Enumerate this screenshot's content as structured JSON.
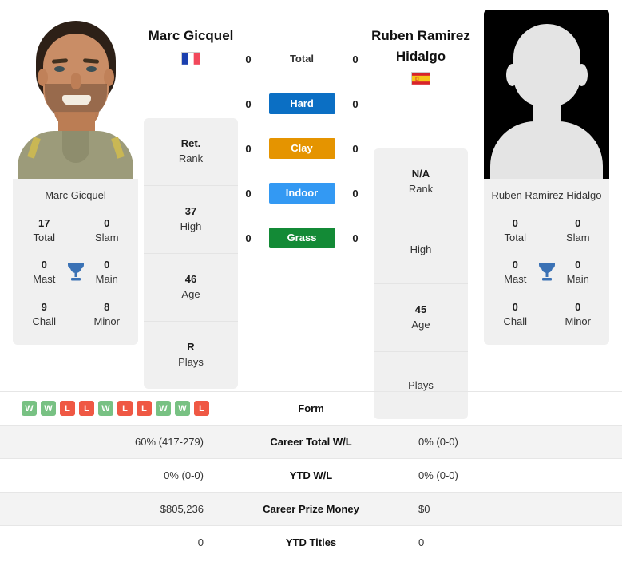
{
  "players": {
    "left": {
      "name": "Marc Gicquel",
      "card_name": "Marc Gicquel",
      "flag": "fr",
      "flag_name": "france-flag-icon",
      "titles": [
        {
          "value": "17",
          "label": "Total"
        },
        {
          "value": "0",
          "label": "Slam"
        },
        {
          "value": "0",
          "label": "Mast"
        },
        {
          "value": "0",
          "label": "Main"
        },
        {
          "value": "9",
          "label": "Chall"
        },
        {
          "value": "8",
          "label": "Minor"
        }
      ],
      "info": [
        {
          "value": "Ret.",
          "label": "Rank"
        },
        {
          "value": "37",
          "label": "High"
        },
        {
          "value": "46",
          "label": "Age"
        },
        {
          "value": "R",
          "label": "Plays"
        }
      ]
    },
    "right": {
      "name": "Ruben Ramirez Hidalgo",
      "card_name": "Ruben Ramirez Hidalgo",
      "flag": "es",
      "flag_name": "spain-flag-icon",
      "titles": [
        {
          "value": "0",
          "label": "Total"
        },
        {
          "value": "0",
          "label": "Slam"
        },
        {
          "value": "0",
          "label": "Mast"
        },
        {
          "value": "0",
          "label": "Main"
        },
        {
          "value": "0",
          "label": "Chall"
        },
        {
          "value": "0",
          "label": "Minor"
        }
      ],
      "info": [
        {
          "value": "N/A",
          "label": "Rank"
        },
        {
          "value": "",
          "label": "High"
        },
        {
          "value": "45",
          "label": "Age"
        },
        {
          "value": "",
          "label": "Plays"
        }
      ]
    }
  },
  "head_to_head": {
    "rows": [
      {
        "label": "Total",
        "left": "0",
        "right": "0",
        "color": "",
        "chip": false
      },
      {
        "label": "Hard",
        "left": "0",
        "right": "0",
        "color": "#0b6fc4",
        "chip": true
      },
      {
        "label": "Clay",
        "left": "0",
        "right": "0",
        "color": "#e59400",
        "chip": true
      },
      {
        "label": "Indoor",
        "left": "0",
        "right": "0",
        "color": "#3399f3",
        "chip": true
      },
      {
        "label": "Grass",
        "left": "0",
        "right": "0",
        "color": "#138a36",
        "chip": true
      }
    ]
  },
  "trophy_icon": "trophy-icon",
  "stats_table": {
    "form": {
      "label": "Form",
      "left_results": [
        "W",
        "W",
        "L",
        "L",
        "W",
        "L",
        "L",
        "W",
        "W",
        "L"
      ],
      "right_results": []
    },
    "rows": [
      {
        "label": "Career Total W/L",
        "left": "60% (417-279)",
        "right": "0% (0-0)"
      },
      {
        "label": "YTD W/L",
        "left": "0% (0-0)",
        "right": "0% (0-0)"
      },
      {
        "label": "Career Prize Money",
        "left": "$805,236",
        "right": "$0"
      },
      {
        "label": "YTD Titles",
        "left": "0",
        "right": "0"
      }
    ]
  },
  "colors": {
    "hard": "#0b6fc4",
    "clay": "#e59400",
    "indoor": "#3399f3",
    "grass": "#138a36",
    "win": "#78c183",
    "loss": "#ef5844",
    "trophy": "#3b72b5",
    "card_bg": "#f0f0f0"
  }
}
